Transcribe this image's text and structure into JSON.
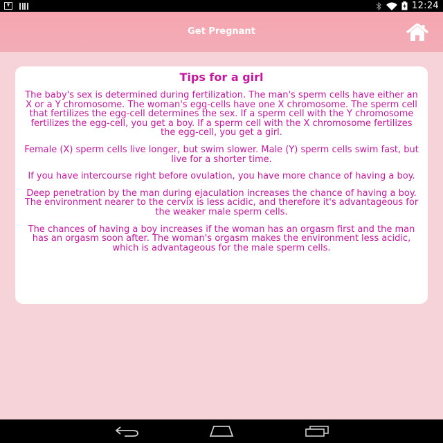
{
  "status_bar": {
    "time": "12:24",
    "icons": [
      "download-icon",
      "barcode-icon",
      "bluetooth-icon",
      "wifi-icon",
      "battery-icon"
    ]
  },
  "app_bar": {
    "title": "Get Pregnant",
    "home_icon": "home-icon",
    "background": "#f4a9b3"
  },
  "card": {
    "title": "Tips for a girl",
    "text_color": "#c8179f",
    "paragraphs": [
      "The baby's sex is determined during fertilization. The man's sperm cells have either an X or a Y chromosome. The woman's egg-cells have one X chromosome. The sperm cell that fertilizes the egg-cell determines the sex. If a sperm cell with the Y chromosome fertilizes the egg-cell, you get a boy. If a sperm cell with the X chromosome fertilizes the egg-cell, you get a girl.",
      "Female (X) sperm cells live longer, but swim slower. Male (Y) sperm cells swim fast, but live for a shorter time.",
      "If you have intercourse right before ovulation, you have more chance of having a boy.",
      "Deep penetration by the man during ejaculation increases the chance of having a boy. The environment nearer to the cervix is less acidic, and therefore it's advantageous for the weaker male sperm cells.",
      "The chances of having a boy increases if the woman has an orgasm first and the man has an orgasm soon after. The woman's orgasm makes the environment less acidic, which is advantageous for the male sperm cells."
    ]
  },
  "nav_bar": {
    "icons": [
      "back-icon",
      "home-nav-icon",
      "recent-apps-icon"
    ]
  },
  "colors": {
    "page_background": "#f6d3d8",
    "card_background": "#ffffff"
  }
}
